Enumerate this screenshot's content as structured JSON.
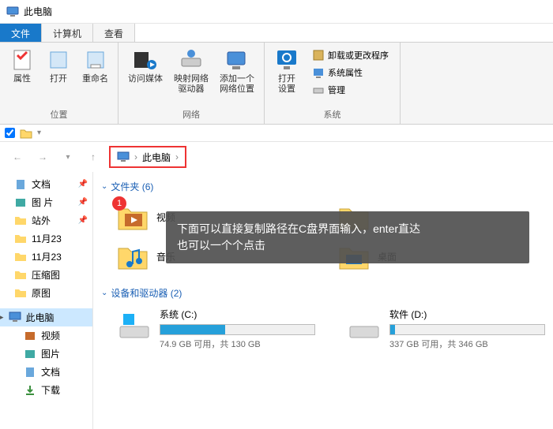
{
  "window": {
    "title": "此电脑"
  },
  "tabs": [
    {
      "label": "文件",
      "active": true
    },
    {
      "label": "计算机",
      "active": false
    },
    {
      "label": "查看",
      "active": false
    }
  ],
  "ribbon": {
    "groups": [
      {
        "label": "位置",
        "buttons": [
          {
            "label": "属性",
            "icon": "properties"
          },
          {
            "label": "打开",
            "icon": "open"
          },
          {
            "label": "重命名",
            "icon": "rename"
          }
        ]
      },
      {
        "label": "网络",
        "buttons": [
          {
            "label": "访问媒体",
            "icon": "media"
          },
          {
            "label": "映射网络\n驱动器",
            "icon": "map-drive"
          },
          {
            "label": "添加一个\n网络位置",
            "icon": "add-net"
          }
        ]
      },
      {
        "label": "系统",
        "buttons": [
          {
            "label": "打开\n设置",
            "icon": "settings"
          }
        ],
        "small": [
          {
            "label": "卸载或更改程序",
            "icon": "uninstall"
          },
          {
            "label": "系统属性",
            "icon": "sysprops"
          },
          {
            "label": "管理",
            "icon": "manage"
          }
        ]
      }
    ]
  },
  "breadcrumb": {
    "root": "此电脑"
  },
  "sidebar": {
    "items": [
      {
        "label": "文档",
        "icon": "doc",
        "pinned": true
      },
      {
        "label": "图 片",
        "icon": "pic",
        "pinned": true
      },
      {
        "label": "站外",
        "icon": "folder",
        "pinned": true
      },
      {
        "label": "11月23",
        "icon": "folder"
      },
      {
        "label": "11月23",
        "icon": "folder"
      },
      {
        "label": "压缩图",
        "icon": "folder"
      },
      {
        "label": "原图",
        "icon": "folder"
      }
    ],
    "thispc": {
      "label": "此电脑",
      "selected": true
    },
    "subs": [
      {
        "label": "视频",
        "icon": "video"
      },
      {
        "label": "图片",
        "icon": "pic"
      },
      {
        "label": "文档",
        "icon": "doc"
      },
      {
        "label": "下载",
        "icon": "download"
      }
    ]
  },
  "sections": {
    "folders": {
      "title": "文件夹 (6)"
    },
    "drives": {
      "title": "设备和驱动器 (2)"
    }
  },
  "folders": [
    {
      "label": "视频",
      "icon": "video",
      "badge": "1"
    },
    {
      "label": "音乐",
      "icon": "music"
    },
    {
      "label": "桌面",
      "icon": "desktop"
    }
  ],
  "drives": [
    {
      "name": "系统 (C:)",
      "free": "74.9 GB 可用，共 130 GB",
      "fill": 42
    },
    {
      "name": "软件 (D:)",
      "free": "337 GB 可用，共 346 GB",
      "fill": 3
    }
  ],
  "overlay": {
    "line1": "下面可以直接复制路径在C盘界面输入，enter直达",
    "line2": "也可以一个个点击"
  }
}
